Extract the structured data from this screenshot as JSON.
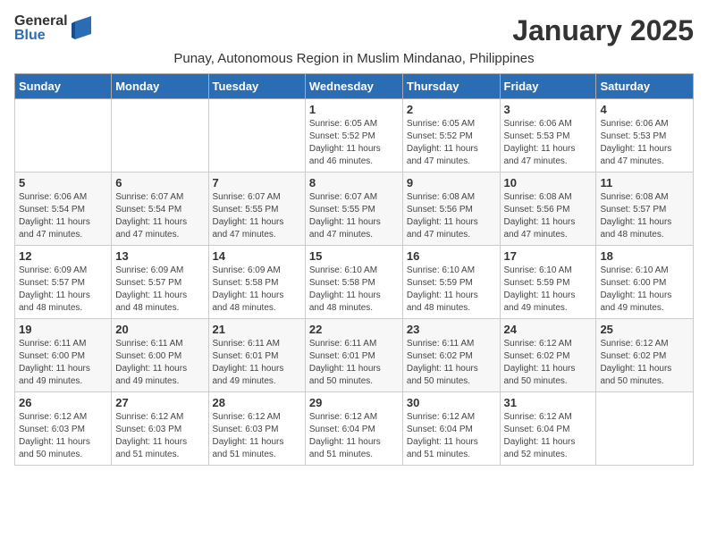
{
  "header": {
    "logo_general": "General",
    "logo_blue": "Blue",
    "month_title": "January 2025",
    "subtitle": "Punay, Autonomous Region in Muslim Mindanao, Philippines"
  },
  "columns": [
    "Sunday",
    "Monday",
    "Tuesday",
    "Wednesday",
    "Thursday",
    "Friday",
    "Saturday"
  ],
  "weeks": [
    [
      {
        "day": "",
        "info": ""
      },
      {
        "day": "",
        "info": ""
      },
      {
        "day": "",
        "info": ""
      },
      {
        "day": "1",
        "info": "Sunrise: 6:05 AM\nSunset: 5:52 PM\nDaylight: 11 hours\nand 46 minutes."
      },
      {
        "day": "2",
        "info": "Sunrise: 6:05 AM\nSunset: 5:52 PM\nDaylight: 11 hours\nand 47 minutes."
      },
      {
        "day": "3",
        "info": "Sunrise: 6:06 AM\nSunset: 5:53 PM\nDaylight: 11 hours\nand 47 minutes."
      },
      {
        "day": "4",
        "info": "Sunrise: 6:06 AM\nSunset: 5:53 PM\nDaylight: 11 hours\nand 47 minutes."
      }
    ],
    [
      {
        "day": "5",
        "info": "Sunrise: 6:06 AM\nSunset: 5:54 PM\nDaylight: 11 hours\nand 47 minutes."
      },
      {
        "day": "6",
        "info": "Sunrise: 6:07 AM\nSunset: 5:54 PM\nDaylight: 11 hours\nand 47 minutes."
      },
      {
        "day": "7",
        "info": "Sunrise: 6:07 AM\nSunset: 5:55 PM\nDaylight: 11 hours\nand 47 minutes."
      },
      {
        "day": "8",
        "info": "Sunrise: 6:07 AM\nSunset: 5:55 PM\nDaylight: 11 hours\nand 47 minutes."
      },
      {
        "day": "9",
        "info": "Sunrise: 6:08 AM\nSunset: 5:56 PM\nDaylight: 11 hours\nand 47 minutes."
      },
      {
        "day": "10",
        "info": "Sunrise: 6:08 AM\nSunset: 5:56 PM\nDaylight: 11 hours\nand 47 minutes."
      },
      {
        "day": "11",
        "info": "Sunrise: 6:08 AM\nSunset: 5:57 PM\nDaylight: 11 hours\nand 48 minutes."
      }
    ],
    [
      {
        "day": "12",
        "info": "Sunrise: 6:09 AM\nSunset: 5:57 PM\nDaylight: 11 hours\nand 48 minutes."
      },
      {
        "day": "13",
        "info": "Sunrise: 6:09 AM\nSunset: 5:57 PM\nDaylight: 11 hours\nand 48 minutes."
      },
      {
        "day": "14",
        "info": "Sunrise: 6:09 AM\nSunset: 5:58 PM\nDaylight: 11 hours\nand 48 minutes."
      },
      {
        "day": "15",
        "info": "Sunrise: 6:10 AM\nSunset: 5:58 PM\nDaylight: 11 hours\nand 48 minutes."
      },
      {
        "day": "16",
        "info": "Sunrise: 6:10 AM\nSunset: 5:59 PM\nDaylight: 11 hours\nand 48 minutes."
      },
      {
        "day": "17",
        "info": "Sunrise: 6:10 AM\nSunset: 5:59 PM\nDaylight: 11 hours\nand 49 minutes."
      },
      {
        "day": "18",
        "info": "Sunrise: 6:10 AM\nSunset: 6:00 PM\nDaylight: 11 hours\nand 49 minutes."
      }
    ],
    [
      {
        "day": "19",
        "info": "Sunrise: 6:11 AM\nSunset: 6:00 PM\nDaylight: 11 hours\nand 49 minutes."
      },
      {
        "day": "20",
        "info": "Sunrise: 6:11 AM\nSunset: 6:00 PM\nDaylight: 11 hours\nand 49 minutes."
      },
      {
        "day": "21",
        "info": "Sunrise: 6:11 AM\nSunset: 6:01 PM\nDaylight: 11 hours\nand 49 minutes."
      },
      {
        "day": "22",
        "info": "Sunrise: 6:11 AM\nSunset: 6:01 PM\nDaylight: 11 hours\nand 50 minutes."
      },
      {
        "day": "23",
        "info": "Sunrise: 6:11 AM\nSunset: 6:02 PM\nDaylight: 11 hours\nand 50 minutes."
      },
      {
        "day": "24",
        "info": "Sunrise: 6:12 AM\nSunset: 6:02 PM\nDaylight: 11 hours\nand 50 minutes."
      },
      {
        "day": "25",
        "info": "Sunrise: 6:12 AM\nSunset: 6:02 PM\nDaylight: 11 hours\nand 50 minutes."
      }
    ],
    [
      {
        "day": "26",
        "info": "Sunrise: 6:12 AM\nSunset: 6:03 PM\nDaylight: 11 hours\nand 50 minutes."
      },
      {
        "day": "27",
        "info": "Sunrise: 6:12 AM\nSunset: 6:03 PM\nDaylight: 11 hours\nand 51 minutes."
      },
      {
        "day": "28",
        "info": "Sunrise: 6:12 AM\nSunset: 6:03 PM\nDaylight: 11 hours\nand 51 minutes."
      },
      {
        "day": "29",
        "info": "Sunrise: 6:12 AM\nSunset: 6:04 PM\nDaylight: 11 hours\nand 51 minutes."
      },
      {
        "day": "30",
        "info": "Sunrise: 6:12 AM\nSunset: 6:04 PM\nDaylight: 11 hours\nand 51 minutes."
      },
      {
        "day": "31",
        "info": "Sunrise: 6:12 AM\nSunset: 6:04 PM\nDaylight: 11 hours\nand 52 minutes."
      },
      {
        "day": "",
        "info": ""
      }
    ]
  ]
}
